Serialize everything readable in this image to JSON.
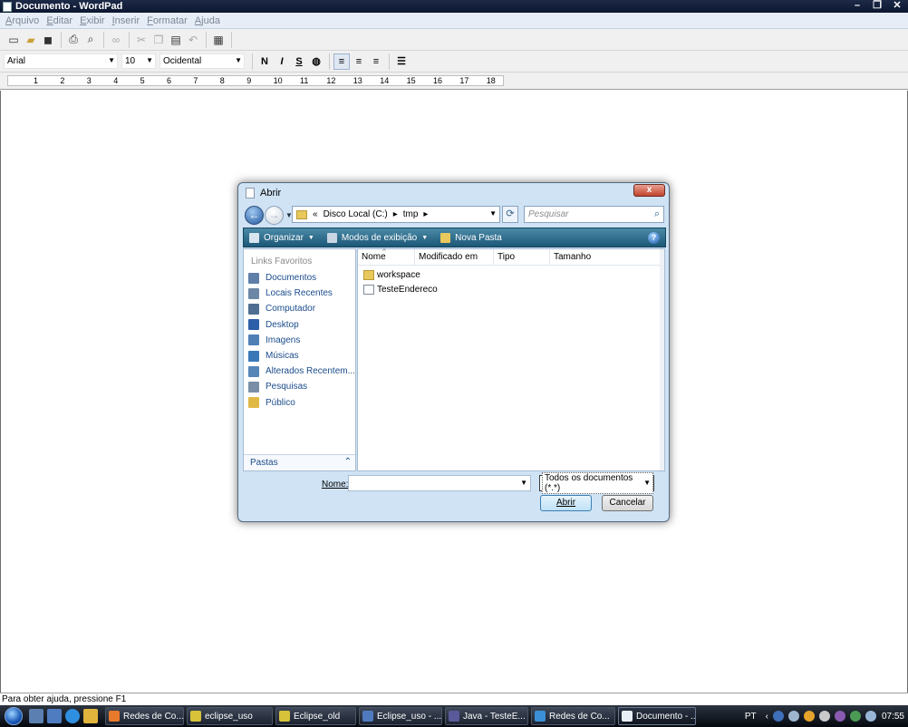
{
  "window": {
    "title": "Documento - WordPad",
    "controls": [
      "–",
      "❐",
      "✕"
    ]
  },
  "menu": [
    "Arquivo",
    "Editar",
    "Exibir",
    "Inserir",
    "Formatar",
    "Ajuda"
  ],
  "format": {
    "font": "Arial",
    "size": "10",
    "script": "Ocidental",
    "bold": "N",
    "italic": "I",
    "underline": "S"
  },
  "ruler": {
    "ticks": [
      "1",
      "2",
      "3",
      "4",
      "5",
      "6",
      "7",
      "8",
      "9",
      "10",
      "11",
      "12",
      "13",
      "14",
      "15",
      "16",
      "17",
      "18"
    ]
  },
  "status": {
    "text": "Para obter ajuda, pressione F1"
  },
  "dialog": {
    "title": "Abrir",
    "close": "x",
    "address": [
      "«",
      "Disco Local (C:)",
      "▸",
      "tmp",
      "▸"
    ],
    "search_placeholder": "Pesquisar",
    "commands": {
      "organize": "Organizar",
      "views": "Modos de exibição",
      "new_folder": "Nova Pasta"
    },
    "help": "?",
    "favorites_header": "Links Favoritos",
    "favorites": [
      {
        "label": "Documentos",
        "color": "#5f7fa8"
      },
      {
        "label": "Locais Recentes",
        "color": "#6c87a6"
      },
      {
        "label": "Computador",
        "color": "#4f6e91"
      },
      {
        "label": "Desktop",
        "color": "#2d5ea8"
      },
      {
        "label": "Imagens",
        "color": "#4f7fb5"
      },
      {
        "label": "Músicas",
        "color": "#3b78b8"
      },
      {
        "label": "Alterados Recentem...",
        "color": "#5685b8"
      },
      {
        "label": "Pesquisas",
        "color": "#7a8ea6"
      },
      {
        "label": "Público",
        "color": "#e0b844"
      }
    ],
    "folders_label": "Pastas",
    "columns": [
      "Nome",
      "Modificado em",
      "Tipo",
      "Tamanho"
    ],
    "files": [
      {
        "name": "workspace",
        "kind": "folder"
      },
      {
        "name": "TesteEndereco",
        "kind": "file"
      }
    ],
    "name_label": "Nome:",
    "name_value": "",
    "file_type": "Todos os documentos (*.*)",
    "open_button": "Abrir",
    "cancel_button": "Cancelar"
  },
  "taskbar": {
    "tasks": [
      {
        "label": "Redes de Co...",
        "color": "#e87a2c"
      },
      {
        "label": "eclipse_uso",
        "color": "#d8c23a"
      },
      {
        "label": "Eclipse_old",
        "color": "#d8c23a"
      },
      {
        "label": "Eclipse_uso - ...",
        "color": "#4f7ac0"
      },
      {
        "label": "Java - TesteE...",
        "color": "#5a5a9a"
      },
      {
        "label": "Redes de Co...",
        "color": "#3b8fd6"
      },
      {
        "label": "Documento - ...",
        "color": "#e8eef6"
      }
    ],
    "language": "PT",
    "clock": "07:55"
  }
}
